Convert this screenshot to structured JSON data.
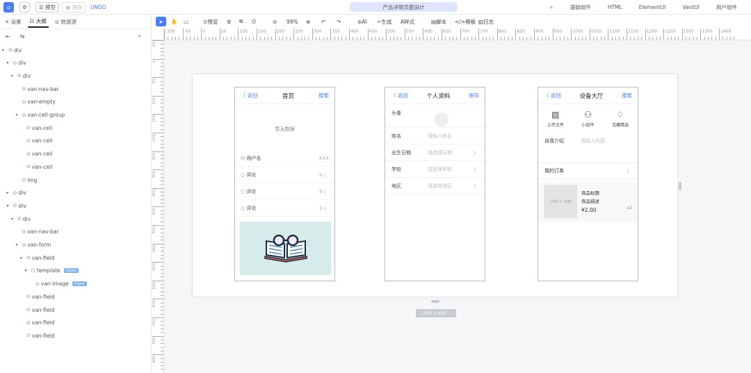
{
  "topbar": {
    "model_label": "模型",
    "save_label": "保存",
    "undo_label": "UNDO",
    "title": "产品详情页面设计",
    "right_items": [
      "基础组件",
      "HTML",
      "ElementUI",
      "VantUI",
      "用户组件"
    ]
  },
  "left_panel": {
    "tabs": [
      "设置",
      "大纲",
      "数据源"
    ],
    "tree": [
      {
        "label": "div",
        "depth": 0,
        "arrow": "▾"
      },
      {
        "label": "div",
        "depth": 1,
        "arrow": "▾"
      },
      {
        "label": "div",
        "depth": 2,
        "arrow": "▾"
      },
      {
        "label": "van-nav-bar",
        "depth": 3,
        "arrow": ""
      },
      {
        "label": "van-empty",
        "depth": 3,
        "arrow": ""
      },
      {
        "label": "van-cell-group",
        "depth": 3,
        "arrow": "▾"
      },
      {
        "label": "van-cell",
        "depth": 4,
        "arrow": ""
      },
      {
        "label": "van-cell",
        "depth": 4,
        "arrow": ""
      },
      {
        "label": "van-cell",
        "depth": 4,
        "arrow": ""
      },
      {
        "label": "van-cell",
        "depth": 4,
        "arrow": ""
      },
      {
        "label": "img",
        "depth": 3,
        "arrow": ""
      },
      {
        "label": "div",
        "depth": 1,
        "arrow": "▸"
      },
      {
        "label": "div",
        "depth": 1,
        "arrow": "▾"
      },
      {
        "label": "div",
        "depth": 2,
        "arrow": "▾"
      },
      {
        "label": "van-nav-bar",
        "depth": 3,
        "arrow": ""
      },
      {
        "label": "van-form",
        "depth": 3,
        "arrow": "▾"
      },
      {
        "label": "van-field",
        "depth": 4,
        "arrow": "▾"
      },
      {
        "label": "template",
        "depth": 5,
        "arrow": "▾",
        "tag": "input",
        "icon": "☐"
      },
      {
        "label": "van-image",
        "depth": 6,
        "arrow": "",
        "tag": "input"
      },
      {
        "label": "van-field",
        "depth": 4,
        "arrow": ""
      },
      {
        "label": "van-field",
        "depth": 4,
        "arrow": ""
      },
      {
        "label": "van-field",
        "depth": 4,
        "arrow": ""
      },
      {
        "label": "van-field",
        "depth": 4,
        "arrow": ""
      }
    ]
  },
  "toolbar2": {
    "items": [
      "预览",
      "99%",
      "AI",
      "生成",
      "样式",
      "脚本",
      "模板",
      "日志"
    ]
  },
  "ruler": {
    "h_labels": [
      "-100",
      "-50",
      "0",
      "50",
      "100",
      "150",
      "200",
      "250",
      "300",
      "350",
      "400",
      "450",
      "500",
      "550",
      "600",
      "650",
      "700",
      "750",
      "800",
      "850",
      "900",
      "950",
      "1000",
      "1050",
      "1100",
      "1150",
      "1200",
      "1250",
      "1300",
      "1350",
      "1400"
    ],
    "v_labels": [
      "-50",
      "0",
      "50",
      "100",
      "150",
      "200",
      "250",
      "300",
      "350",
      "400",
      "450",
      "500",
      "550",
      "600",
      "650",
      "700",
      "750",
      "800",
      "850"
    ]
  },
  "phone1": {
    "back": "返回",
    "title": "首页",
    "action": "搜索",
    "empty_text": "暂无数据",
    "cells": [
      {
        "label": "用户名",
        "value": "XXX"
      },
      {
        "label": "评论",
        "value": "0 〉"
      },
      {
        "label": "评论",
        "value": "0 〉"
      },
      {
        "label": "评论",
        "value": "0 〉"
      }
    ]
  },
  "phone2": {
    "back": "返回",
    "title": "个人资料",
    "action": "保存",
    "avatar_label": "头像",
    "fields": [
      {
        "label": "姓名",
        "placeholder": "请输入姓名",
        "chev": ""
      },
      {
        "label": "出生日期",
        "placeholder": "请选择日期",
        "chev": "〉"
      },
      {
        "label": "学校",
        "placeholder": "请选择学校",
        "chev": "〉"
      },
      {
        "label": "地区",
        "placeholder": "请选择地区",
        "chev": "〉"
      }
    ]
  },
  "phone3": {
    "back": "返回",
    "title": "设备大厅",
    "action": "搜索",
    "grid": [
      "上传文件",
      "小组件",
      "宝藏精选"
    ],
    "intro_label": "自我介绍",
    "intro_placeholder": "请输入内容",
    "my_orders": "我的订单",
    "thumb": "100 × 100",
    "product_title": "商品标题",
    "product_desc": "商品描述",
    "price": "¥2.00",
    "qty": "x2"
  },
  "canvas_size": "1300 x 600"
}
